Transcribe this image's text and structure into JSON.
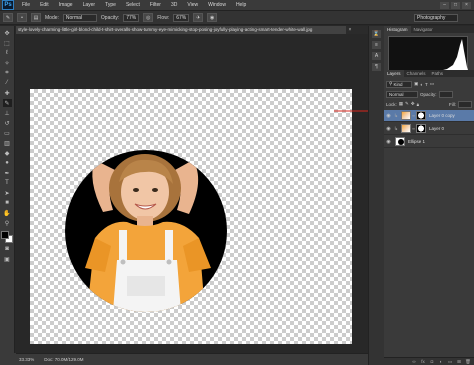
{
  "app": {
    "logo": "Ps"
  },
  "menu": {
    "items": [
      {
        "label": "File"
      },
      {
        "label": "Edit"
      },
      {
        "label": "Image"
      },
      {
        "label": "Layer"
      },
      {
        "label": "Type"
      },
      {
        "label": "Select"
      },
      {
        "label": "Filter"
      },
      {
        "label": "3D"
      },
      {
        "label": "View"
      },
      {
        "label": "Window"
      },
      {
        "label": "Help"
      }
    ]
  },
  "options_bar": {
    "mode_label": "Mode:",
    "mode_value": "Normal",
    "opacity_label": "Opacity:",
    "opacity_value": "77%",
    "flow_label": "Flow:",
    "flow_value": "67%",
    "workspace": "Photography"
  },
  "document": {
    "tab_title": "style-lovely-charming-little-girl-blond-child-t-shirt-overalls-show-tummy-eye-mimicking-stop-posing-joyfully-playing-acting-smart-tender-white-wall.jpg",
    "close": "×"
  },
  "status": {
    "zoom": "33.33%",
    "doc_size": "Doc: 70.0M/129.0M"
  },
  "panels": {
    "top_tabs": [
      {
        "label": "Histogram"
      },
      {
        "label": "Navigator"
      }
    ],
    "layer_tabs": [
      {
        "label": "Layers"
      },
      {
        "label": "Channels"
      },
      {
        "label": "Paths"
      }
    ],
    "kind_label": "Kind",
    "blend_mode": "Normal",
    "opacity_label": "Opacity:",
    "lock_label": "Lock:",
    "fill_label": "Fill:",
    "layers": [
      {
        "name": "Layer 0 copy",
        "selected": true
      },
      {
        "name": "Layer 0",
        "selected": false
      },
      {
        "name": "Ellipse 1",
        "selected": false
      }
    ]
  },
  "colors": {
    "selected_layer": "#5a7aa8",
    "annotation_arrow": "#d9261c"
  }
}
